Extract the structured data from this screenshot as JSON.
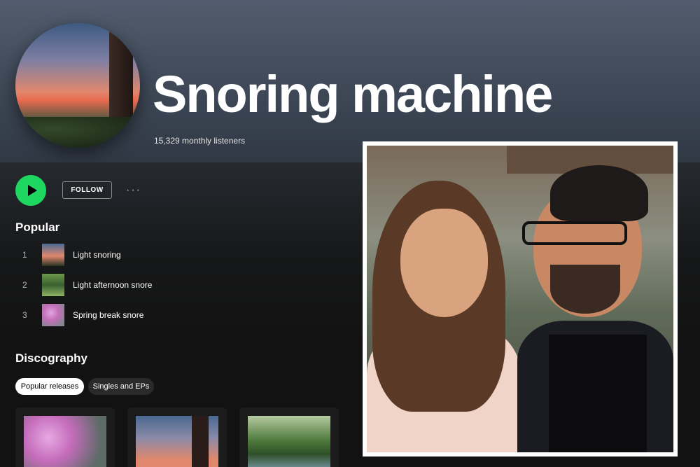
{
  "artist": {
    "name": "Snoring machine",
    "monthly_listeners": "15,329 monthly listeners"
  },
  "actions": {
    "play_icon": "play-icon",
    "follow_label": "FOLLOW",
    "more_label": "···"
  },
  "popular": {
    "title": "Popular",
    "tracks": [
      {
        "number": "1",
        "name": "Light snoring",
        "thumb": "sunset"
      },
      {
        "number": "2",
        "name": "Light afternoon snore",
        "thumb": "tree"
      },
      {
        "number": "3",
        "name": "Spring break snore",
        "thumb": "flower"
      }
    ]
  },
  "discography": {
    "title": "Discography",
    "filters": [
      "Popular releases",
      "Singles and EPs"
    ],
    "active_filter": "Popular releases"
  },
  "colors": {
    "accent": "#1ed760",
    "background": "#121212",
    "header": "#515d6e"
  }
}
